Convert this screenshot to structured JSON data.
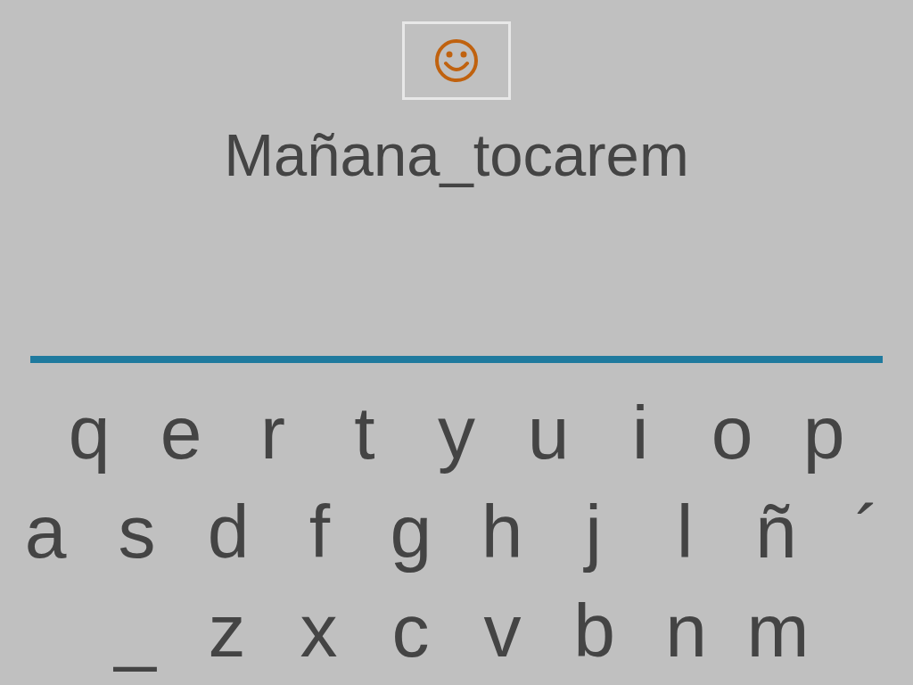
{
  "word": "Mañana_tocarem",
  "keyboard": {
    "rows": [
      [
        "q",
        "e",
        "r",
        "t",
        "y",
        "u",
        "i",
        "o",
        "p"
      ],
      [
        "a",
        "s",
        "d",
        "f",
        "g",
        "h",
        "j",
        "l",
        "ñ",
        "´"
      ],
      [
        "_",
        "z",
        "x",
        "c",
        "v",
        "b",
        "n",
        "m"
      ]
    ]
  }
}
